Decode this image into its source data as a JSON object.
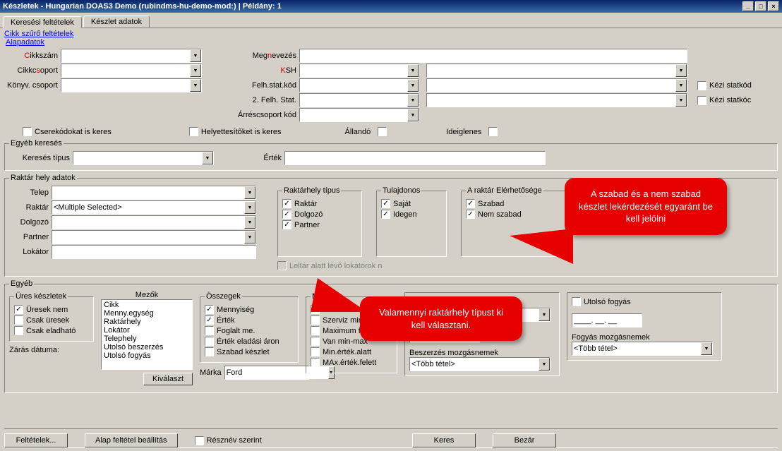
{
  "window": {
    "title": "Készletek - Hungarian DOAS3 Demo (rubindms-hu-demo-mod:)  |  Példány: 1",
    "min_icon": "_",
    "max_icon": "□",
    "close_icon": "×"
  },
  "tabs": {
    "tab_search": "Keresési feltételek",
    "tab_stock": "Készlet adatok"
  },
  "filter_header": "Cikk szűrő feltételek",
  "alap_link": "Alapadatok",
  "form": {
    "cikkszam": {
      "prefix": "C",
      "label": "ikkszám"
    },
    "cikkcsoport": {
      "prefix": "Cikkc",
      "red": "s",
      "rest": "oport"
    },
    "konyvcsoport": "Könyv. csoport",
    "megnevezes": {
      "prefix": "Meg",
      "red": "n",
      "rest": "evezés"
    },
    "ksh": {
      "red": "K",
      "rest": "SH"
    },
    "felhstat": "Felh.stat.kód",
    "felhstat2": "2. Felh. Stat.",
    "arrescsoport": "Árréscsoport kód",
    "kezistat1": "Kézi statkód",
    "kezistat2": "Kézi statkóc"
  },
  "opts_row": {
    "cserekod": "Cserekódokat is keres",
    "helyettes": "Helyettesítőket is keres",
    "allando": "Állandó",
    "ideiglenes": "Ideiglenes"
  },
  "egyebkereses": {
    "legend": "Egyéb keresés",
    "tipus": "Keresés típus",
    "ertek": "Érték"
  },
  "raktarhely": {
    "legend": "Raktár hely adatok",
    "telep": "Telep",
    "raktar": "Raktár",
    "raktar_value": "<Multiple Selected>",
    "dolgozo": "Dolgozó",
    "partner": "Partner",
    "lokator": "Lokátor",
    "rht_legend": "Raktárhely típus",
    "rht_raktar": "Raktár",
    "rht_dolgozo": "Dolgozó",
    "rht_partner": "Partner",
    "leltar_alatt": "Leltár alatt lévő lokátorok n",
    "tulaj_legend": "Tulajdonos",
    "tulaj_sajat": "Saját",
    "tulaj_idegen": "Idegen",
    "elerheto_legend": "A raktár Elérhetősége",
    "elerheto_szabad": "Szabad",
    "elerheto_nemszabad": "Nem szabad"
  },
  "egyeb": {
    "legend": "Egyéb",
    "ures_legend": "Üres készletek",
    "ures_nem": "Üresek nem",
    "csak_ures": "Csak üresek",
    "csak_elad": "Csak eladható",
    "zaras": "Zárás dátuma:",
    "mezok_legend": "Mezők",
    "mezok": [
      "Cikk",
      "Menny.egység",
      "Raktárhely",
      "Lokátor",
      "Telephely",
      "Utolsó beszerzés",
      "Utolsó fogyás"
    ],
    "kivalaszt_btn": "Kiválaszt",
    "osszegek_legend": "Összegek",
    "oss_menny": "Mennyiség",
    "oss_ertek": "Érték",
    "oss_foglalt": "Foglalt me.",
    "oss_eladasi": "Érték eladási áron",
    "oss_szabad": "Szabad készlet",
    "marka_label": "Márka",
    "marka_value": "Ford",
    "minmax_legend": "Min-max",
    "mm_minalatt": "Minimum alatt",
    "mm_szerviz": "Szerviz min.alatt",
    "mm_maxfelett": "Maximum felett",
    "mm_vanminmax": "Van min-max",
    "mm_minertek": "Min.érték.alatt",
    "mm_maxertek": "MAx.érték.felett",
    "date_placeholder": "____. __. __",
    "utolsobesz_lbl": "",
    "besz_mozgas": "Beszerzés mozgásnemek",
    "tobbtetel": "<Több tétel>",
    "utolsofogy_lbl": "Utolsó fogyás",
    "fogy_mozgas": "Fogyás mozgásnemek"
  },
  "buttons": {
    "feltetelek": "Feltételek...",
    "alap": "Alap feltétel beállítás",
    "resznev": "Résznév szerint",
    "keres": "Keres",
    "bezar": "Bezár"
  },
  "callouts": {
    "c1": "A szabad és a nem szabad készlet lekérdezését egyaránt be kell jelölni",
    "c2": "Valamennyi raktárhely típust ki kell választani."
  }
}
